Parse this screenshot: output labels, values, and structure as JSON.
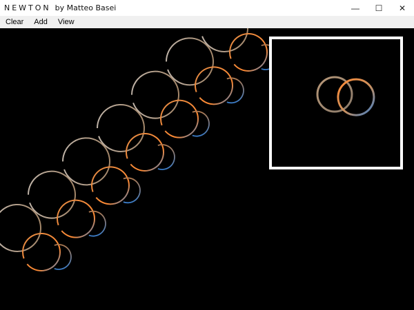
{
  "window": {
    "title": "NEWTON",
    "author": "by Matteo Basei",
    "controls": {
      "minimize": "—",
      "maximize": "☐",
      "close": "✕"
    }
  },
  "menu": {
    "items": [
      {
        "id": "clear",
        "label": "Clear"
      },
      {
        "id": "add",
        "label": "Add"
      },
      {
        "id": "view",
        "label": "View"
      }
    ]
  },
  "colors": {
    "background": "#000000",
    "trail_gray": "#a89480",
    "trail_orange": "#ff8a33",
    "trail_blue": "#3a7cc8",
    "minimap_border": "#ffffff"
  }
}
